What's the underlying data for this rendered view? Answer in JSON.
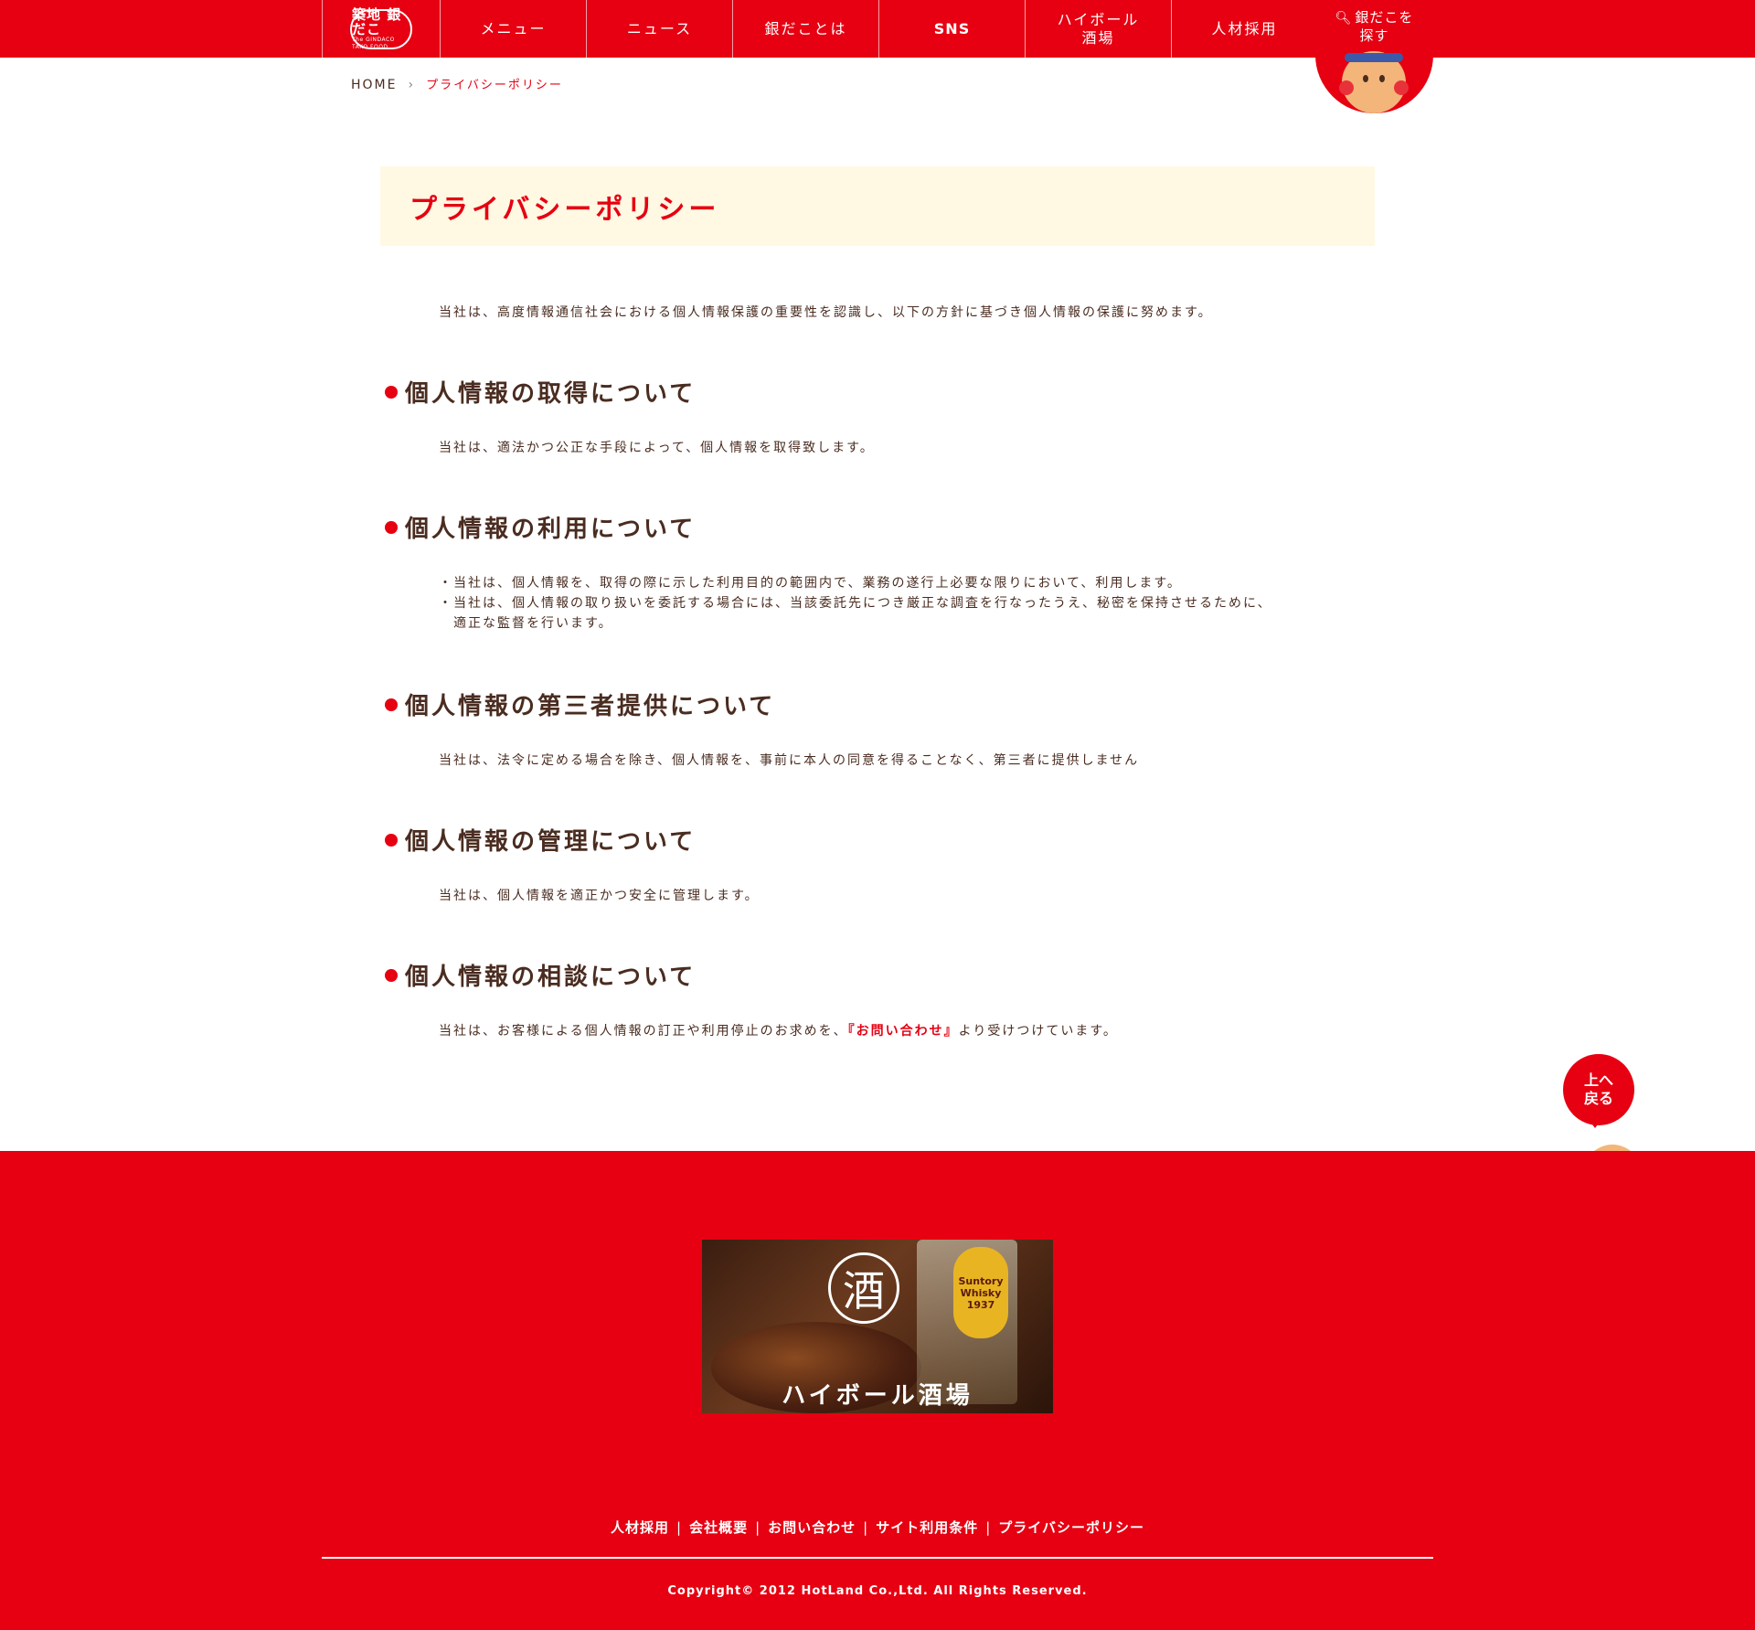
{
  "header": {
    "logo": {
      "line1": "築地 銀だこ",
      "line2": "The GINDACO TAKO FOOD."
    },
    "nav": [
      {
        "label": "メニュー"
      },
      {
        "label": "ニュース"
      },
      {
        "label": "銀だことは"
      },
      {
        "label": "SNS"
      },
      {
        "label": "ハイボール\n酒場"
      },
      {
        "label": "人材採用"
      }
    ],
    "search": {
      "label": "銀だこを\n探す"
    }
  },
  "breadcrumb": {
    "home": "HOME",
    "separator": "›",
    "current": "プライバシーポリシー"
  },
  "page": {
    "title": "プライバシーポリシー",
    "intro": "当社は、高度情報通信社会における個人情報保護の重要性を認識し、以下の方針に基づき個人情報の保護に努めます。",
    "sections": [
      {
        "heading": "個人情報の取得について",
        "body": "当社は、適法かつ公正な手段によって、個人情報を取得致します。"
      },
      {
        "heading": "個人情報の利用について",
        "bullets": [
          "・当社は、個人情報を、取得の際に示した利用目的の範囲内で、業務の遂行上必要な限りにおいて、利用します。",
          "・当社は、個人情報の取り扱いを委託する場合には、当該委託先につき厳正な調査を行なったうえ、秘密を保持させるために、\n適正な監督を行います。"
        ]
      },
      {
        "heading": "個人情報の第三者提供について",
        "body": "当社は、法令に定める場合を除き、個人情報を、事前に本人の同意を得ることなく、第三者に提供しません"
      },
      {
        "heading": "個人情報の管理について",
        "body": "当社は、個人情報を適正かつ安全に管理します。"
      },
      {
        "heading": "個人情報の相談について",
        "body_before": "当社は、お客様による個人情報の訂正や利用停止のお求めを、",
        "link": "『お問い合わせ』",
        "body_after": "より受けつけています。"
      }
    ]
  },
  "to_top": {
    "label": "上へ\n戻る"
  },
  "footer": {
    "banner": {
      "icon_char": "酒",
      "whisky_label": "Suntory\nWhisky\n1937",
      "caption": "ハイボール酒場"
    },
    "links": [
      "人材採用",
      "会社概要",
      "お問い合わせ",
      "サイト利用条件",
      "プライバシーポリシー"
    ],
    "separator": "|",
    "copyright": "Copyright© 2012 HotLand Co.,Ltd. All Rights Reserved."
  },
  "colors": {
    "brand_red": "#e60012",
    "title_bg": "#fff8e3",
    "text_brown": "#4a2c20"
  },
  "icons": [
    "search-icon",
    "mascot-icon"
  ]
}
